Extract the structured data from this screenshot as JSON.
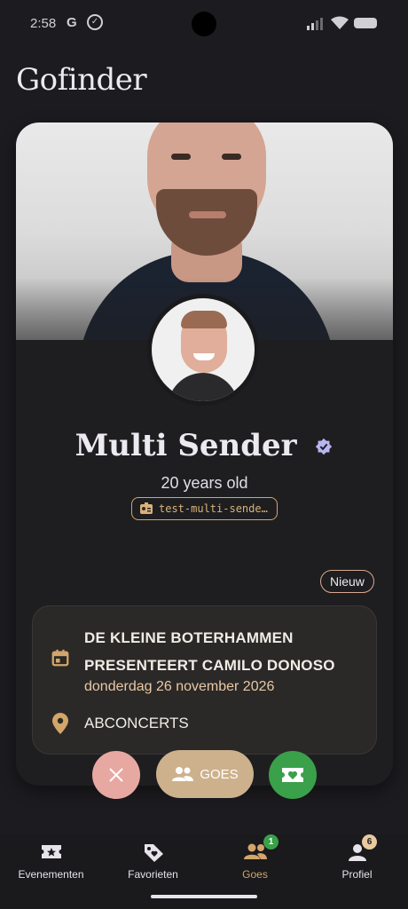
{
  "status_bar": {
    "time": "2:58",
    "g": "G",
    "check": "✓"
  },
  "app": {
    "title": "Gofinder"
  },
  "profile": {
    "name": "Multi Sender",
    "age": "20 years old",
    "username": "test-multi-sende…",
    "badge": "Nieuw"
  },
  "event": {
    "title_line1": "DE KLEINE BOTERHAMMEN",
    "title_line2": "PRESENTEERT CAMILO DONOSO",
    "date": "donderdag 26 november 2026",
    "venue": "ABCONCERTS"
  },
  "actions": {
    "goes_label": "GOES"
  },
  "nav": {
    "items": [
      {
        "label": "Evenementen"
      },
      {
        "label": "Favorieten"
      },
      {
        "label": "Goes",
        "badge": "1"
      },
      {
        "label": "Profiel",
        "badge": "6"
      }
    ]
  },
  "colors": {
    "accent": "#d2a56a",
    "reject": "#e8a8a2",
    "goes": "#cdb18c",
    "ticket": "#3aa04a"
  }
}
